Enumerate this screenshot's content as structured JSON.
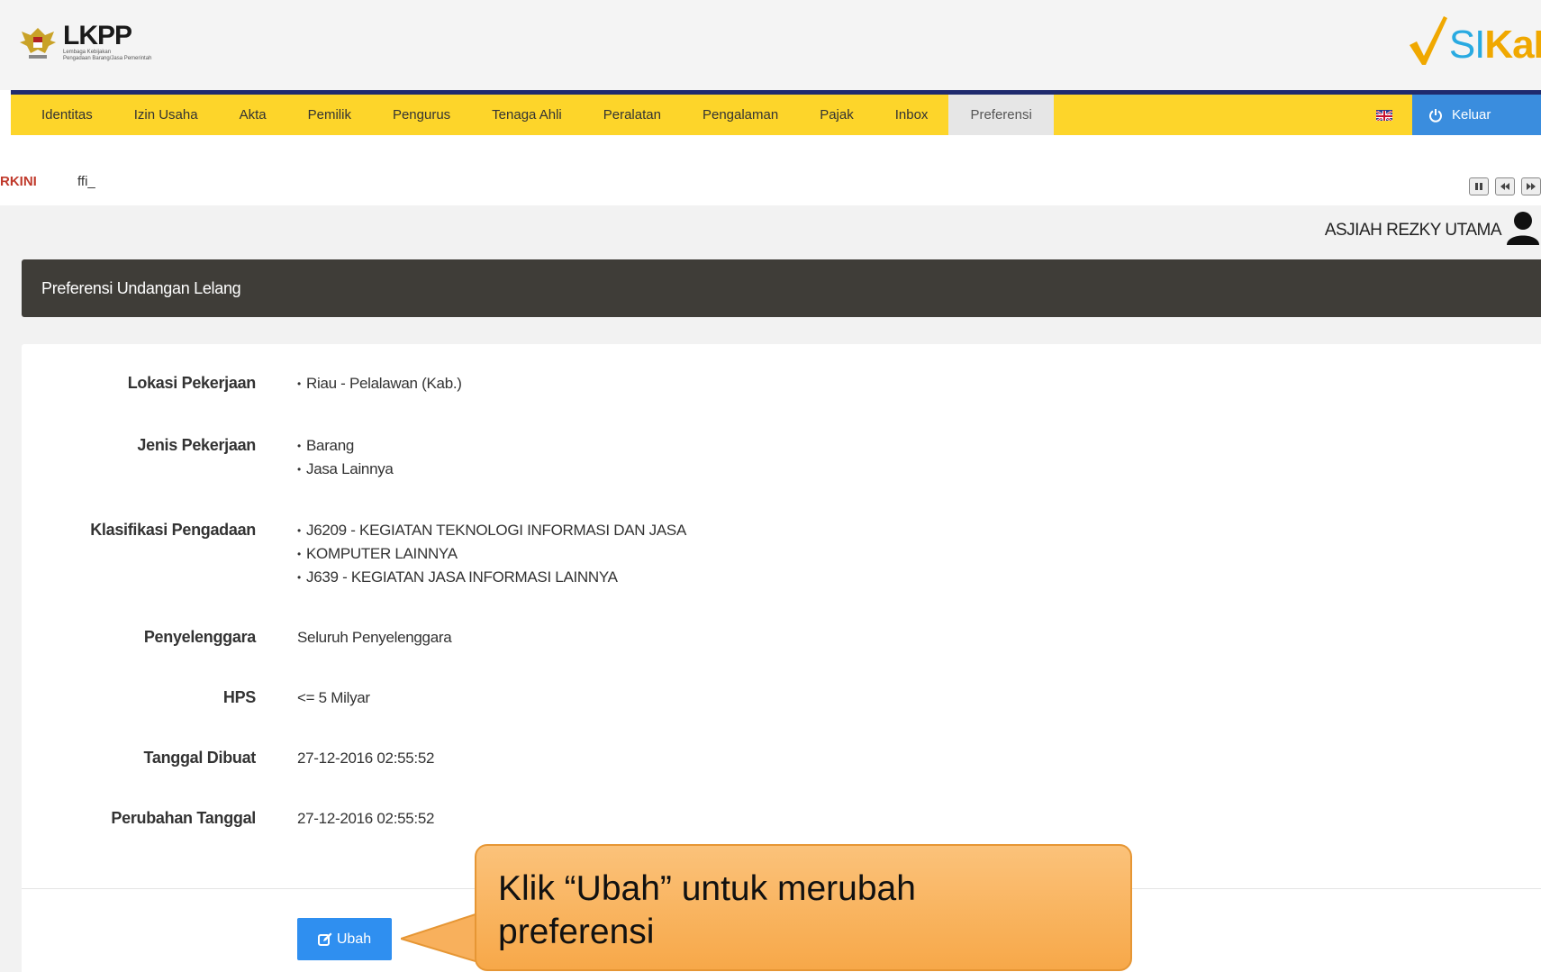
{
  "header": {
    "left_logo": {
      "brand": "LKPP",
      "subtitle_line1": "Lembaga Kebijakan",
      "subtitle_line2": "Pengadaan Barang/Jasa Pemerintah"
    },
    "right_logo": {
      "brand_si": "SI",
      "brand_ka": "KaP"
    }
  },
  "nav": {
    "items": [
      {
        "label": "Identitas"
      },
      {
        "label": "Izin Usaha"
      },
      {
        "label": "Akta"
      },
      {
        "label": "Pemilik"
      },
      {
        "label": "Pengurus"
      },
      {
        "label": "Tenaga Ahli"
      },
      {
        "label": "Peralatan"
      },
      {
        "label": "Pengalaman"
      },
      {
        "label": "Pajak"
      },
      {
        "label": "Inbox"
      },
      {
        "label": "Preferensi",
        "active": true
      }
    ],
    "logout_label": "Keluar"
  },
  "ticker": {
    "label": "RKINI",
    "text": "ffi_"
  },
  "user": {
    "name": "ASJIAH REZKY UTAMA"
  },
  "panel": {
    "title": "Preferensi Undangan Lelang",
    "fields": {
      "lokasi": {
        "label": "Lokasi Pekerjaan",
        "values": [
          "Riau - Pelalawan (Kab.)"
        ]
      },
      "jenis": {
        "label": "Jenis Pekerjaan",
        "values": [
          "Barang",
          "Jasa Lainnya"
        ]
      },
      "klasifikasi": {
        "label": "Klasifikasi Pengadaan",
        "values": [
          "J6209 - KEGIATAN TEKNOLOGI INFORMASI DAN JASA",
          "KOMPUTER LAINNYA",
          "J639 - KEGIATAN JASA INFORMASI LAINNYA"
        ]
      },
      "penyelenggara": {
        "label": "Penyelenggara",
        "value": "Seluruh Penyelenggara"
      },
      "hps": {
        "label": "HPS",
        "value": "<= 5 Milyar"
      },
      "tanggal_dibuat": {
        "label": "Tanggal Dibuat",
        "value": "27-12-2016 02:55:52"
      },
      "perubahan_tanggal": {
        "label": "Perubahan Tanggal",
        "value": "27-12-2016 02:55:52"
      }
    },
    "edit_button_label": "Ubah"
  },
  "callout": {
    "line1": "Klik “Ubah” untuk merubah",
    "line2": "preferensi"
  },
  "colors": {
    "nav_bg": "#fdd52a",
    "nav_border": "#1f2a6e",
    "logout_bg": "#3a8dde",
    "panel_head_bg": "#3f3d38",
    "button_bg": "#2f8ff0",
    "callout_bg": "#f7a849"
  }
}
